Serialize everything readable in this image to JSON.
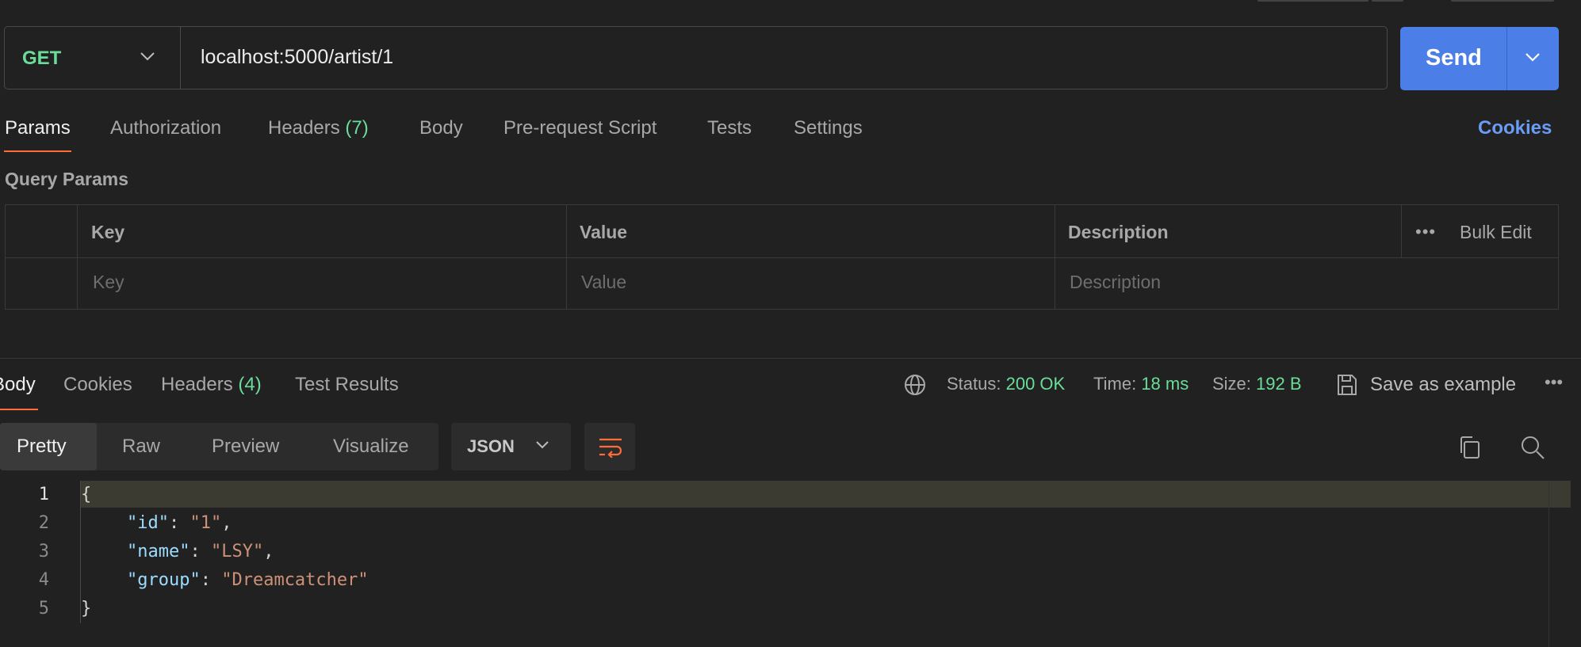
{
  "request": {
    "method": "GET",
    "url": "localhost:5000/artist/1",
    "send_label": "Send"
  },
  "request_tabs": [
    {
      "label": "Params"
    },
    {
      "label": "Authorization"
    },
    {
      "label": "Headers",
      "count": "(7)"
    },
    {
      "label": "Body"
    },
    {
      "label": "Pre-request Script"
    },
    {
      "label": "Tests"
    },
    {
      "label": "Settings"
    }
  ],
  "cookies_link": "Cookies",
  "query_params": {
    "title": "Query Params",
    "columns": [
      "Key",
      "Value",
      "Description"
    ],
    "bulk_edit": "Bulk Edit",
    "placeholders": [
      "Key",
      "Value",
      "Description"
    ]
  },
  "response_tabs": [
    {
      "label": "Body"
    },
    {
      "label": "Cookies"
    },
    {
      "label": "Headers",
      "count": "(4)"
    },
    {
      "label": "Test Results"
    }
  ],
  "response_meta": {
    "status_label": "Status:",
    "status": "200 OK",
    "time_label": "Time:",
    "time": "18 ms",
    "size_label": "Size:",
    "size": "192 B",
    "save_example": "Save as example"
  },
  "view_tabs": [
    "Pretty",
    "Raw",
    "Preview",
    "Visualize"
  ],
  "format": "JSON",
  "code_lines": [
    {
      "n": "1",
      "text": "{"
    },
    {
      "n": "2",
      "key": "\"id\"",
      "sep": ": ",
      "val": "\"1\"",
      "end": ","
    },
    {
      "n": "3",
      "key": "\"name\"",
      "sep": ": ",
      "val": "\"LSY\"",
      "end": ","
    },
    {
      "n": "4",
      "key": "\"group\"",
      "sep": ": ",
      "val": "\"Dreamcatcher\"",
      "end": ""
    },
    {
      "n": "5",
      "text": "}"
    }
  ],
  "colors": {
    "accent": "#ff6c37",
    "primary": "#4c7ee8",
    "success": "#6bdd9a"
  }
}
